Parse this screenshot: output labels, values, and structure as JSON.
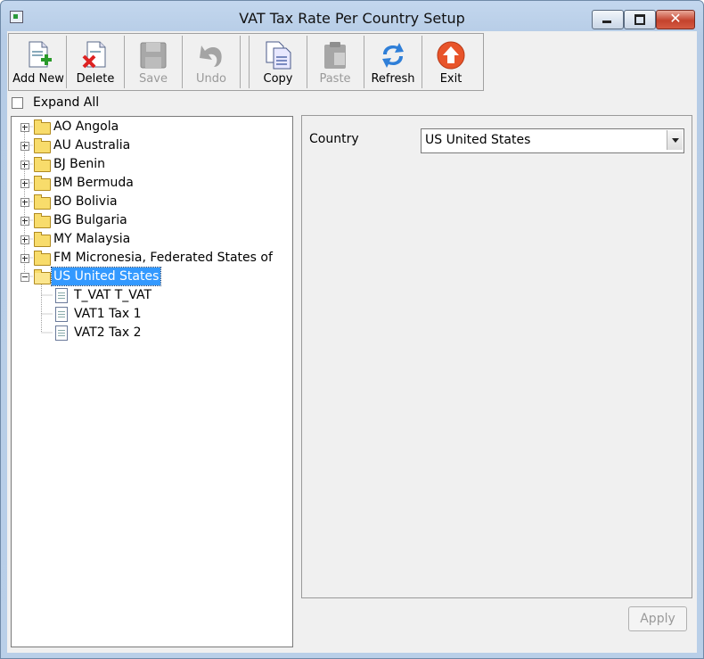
{
  "window": {
    "title": "VAT Tax Rate Per Country Setup",
    "minimize_glyph": "",
    "maximize_glyph": "",
    "close_glyph": "✕"
  },
  "toolbar": {
    "buttons": [
      {
        "label": "Add New",
        "icon": "add-new-icon",
        "enabled": true
      },
      {
        "label": "Delete",
        "icon": "delete-icon",
        "enabled": true
      },
      {
        "label": "Save",
        "icon": "save-icon",
        "enabled": false
      },
      {
        "label": "Undo",
        "icon": "undo-icon",
        "enabled": false
      },
      {
        "label": "Copy",
        "icon": "copy-icon",
        "enabled": true
      },
      {
        "label": "Paste",
        "icon": "paste-icon",
        "enabled": false
      },
      {
        "label": "Refresh",
        "icon": "refresh-icon",
        "enabled": true
      },
      {
        "label": "Exit",
        "icon": "exit-icon",
        "enabled": true
      }
    ]
  },
  "expand_all": {
    "label": "Expand All",
    "checked": false
  },
  "tree": {
    "countries": [
      {
        "label": "AO Angola",
        "expanded": false
      },
      {
        "label": "AU Australia",
        "expanded": false
      },
      {
        "label": "BJ Benin",
        "expanded": false
      },
      {
        "label": "BM Bermuda",
        "expanded": false
      },
      {
        "label": "BO Bolivia",
        "expanded": false
      },
      {
        "label": "BG Bulgaria",
        "expanded": false
      },
      {
        "label": "MY Malaysia",
        "expanded": false
      },
      {
        "label": "FM Micronesia, Federated States of",
        "expanded": false
      },
      {
        "label": "US United States",
        "expanded": true,
        "selected": true
      }
    ],
    "children": [
      {
        "label": "T_VAT T_VAT"
      },
      {
        "label": "VAT1 Tax 1"
      },
      {
        "label": "VAT2 Tax 2"
      }
    ]
  },
  "details": {
    "country_label": "Country",
    "country_value": "US United States"
  },
  "footer": {
    "apply_label": "Apply"
  },
  "colors": {
    "selection": "#3399ff",
    "folder": "#f8dc6b",
    "close_button": "#c4432d"
  }
}
